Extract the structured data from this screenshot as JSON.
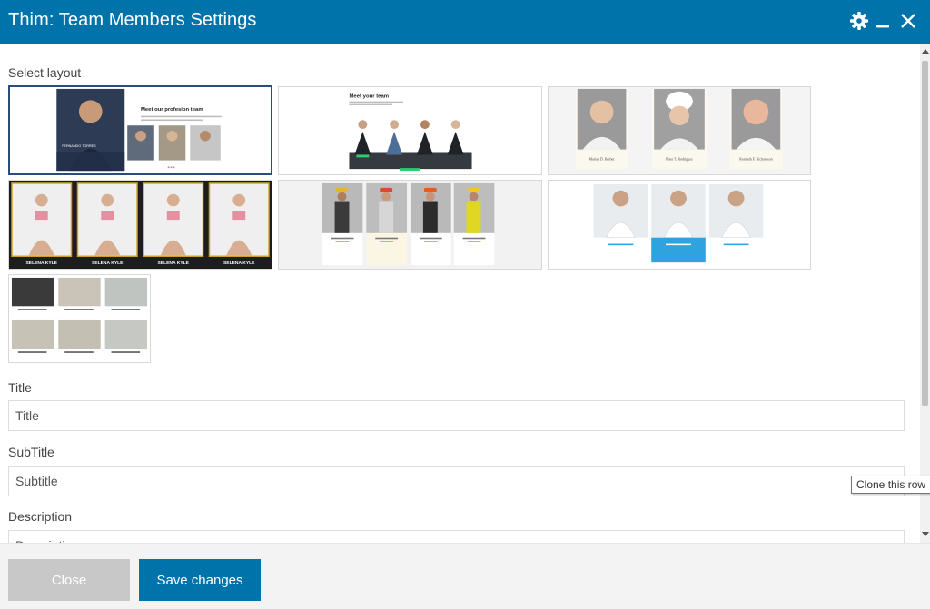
{
  "window": {
    "title": "Thim: Team Members Settings",
    "icons": [
      "gear-icon",
      "minimize-icon",
      "close-icon"
    ]
  },
  "form": {
    "layout_label": "Select layout",
    "layouts": [
      {
        "name": "layout-1",
        "heading": "Meet our profesion team",
        "person": "FERNANDO TORRES"
      },
      {
        "name": "layout-2",
        "heading": "Meet your team"
      },
      {
        "name": "layout-3",
        "captions": [
          "Marian D. Barber",
          "Peter T. Rodriguez",
          "Kenneth F. Richardson"
        ]
      },
      {
        "name": "layout-4",
        "captions": [
          "SELENA KYLE",
          "SELENA KYLE",
          "SELENA KYLE",
          "SELENA KYLE"
        ]
      },
      {
        "name": "layout-5"
      },
      {
        "name": "layout-6"
      },
      {
        "name": "layout-7"
      }
    ],
    "title_label": "Title",
    "title_value": "Title",
    "subtitle_label": "SubTitle",
    "subtitle_value": "Subtitle",
    "description_label": "Description",
    "description_value": "Description"
  },
  "tooltip": "Clone this row",
  "footer": {
    "close_label": "Close",
    "save_label": "Save changes"
  },
  "colors": {
    "header": "#0073aa",
    "save_button": "#0073aa",
    "close_button": "#c8c8c8"
  }
}
